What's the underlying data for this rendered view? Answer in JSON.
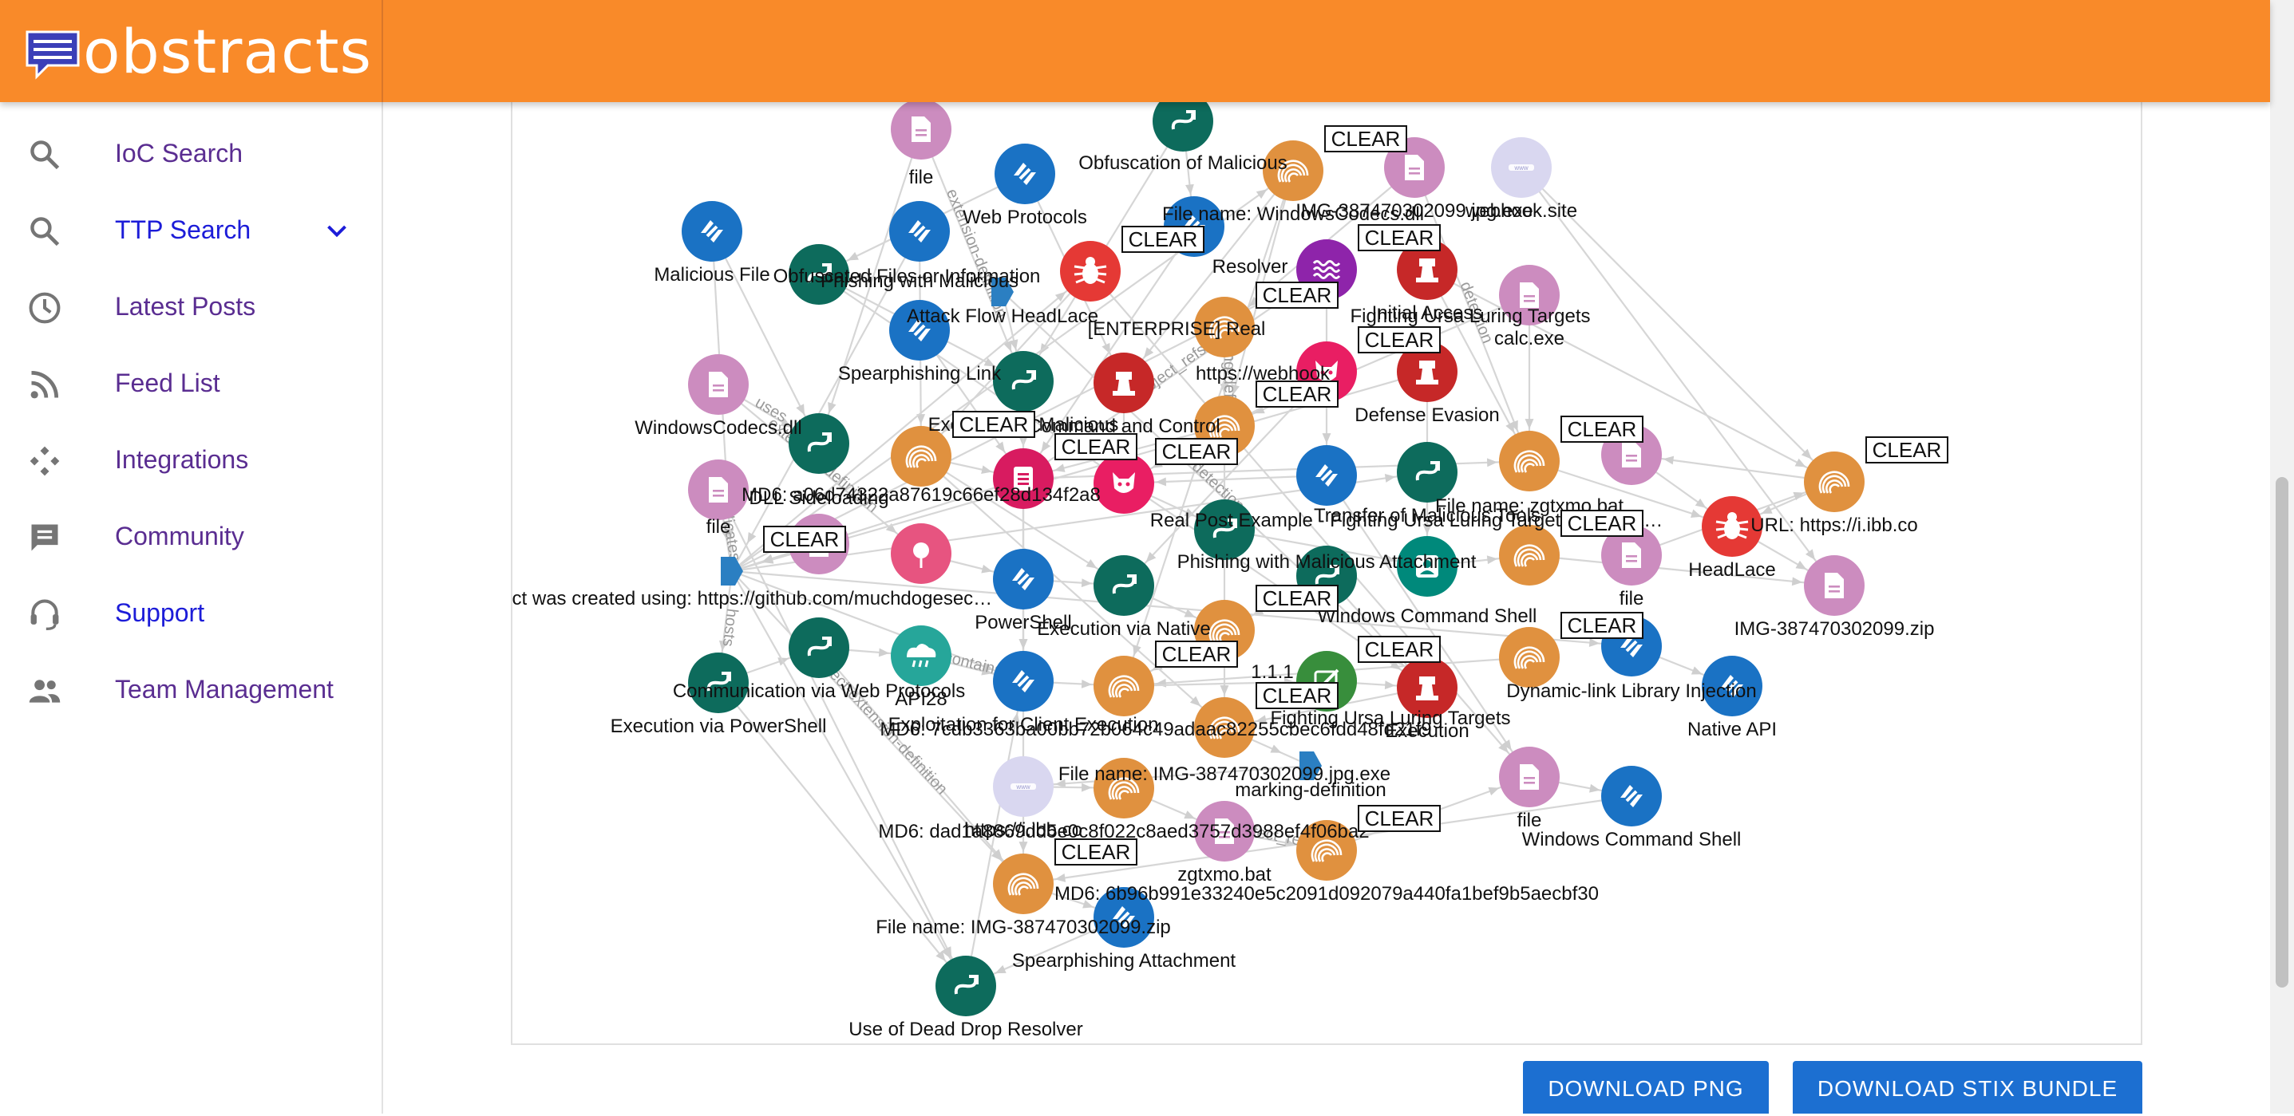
{
  "brand": {
    "name": "obstracts"
  },
  "nav": [
    {
      "key": "ioc",
      "label": "IoC Search",
      "icon": "search-icon",
      "active": false
    },
    {
      "key": "ttp",
      "label": "TTP Search",
      "icon": "search-icon",
      "active": true,
      "expandable": true
    },
    {
      "key": "latest",
      "label": "Latest Posts",
      "icon": "clock-icon",
      "active": false
    },
    {
      "key": "feeds",
      "label": "Feed List",
      "icon": "rss-icon",
      "active": false
    },
    {
      "key": "integrations",
      "label": "Integrations",
      "icon": "integrations-icon",
      "active": false
    },
    {
      "key": "community",
      "label": "Community",
      "icon": "chat-icon",
      "active": false
    },
    {
      "key": "support",
      "label": "Support",
      "icon": "support-icon",
      "active": true
    },
    {
      "key": "team",
      "label": "Team Management",
      "icon": "team-icon",
      "active": false
    }
  ],
  "buttons": {
    "download_png": "DOWNLOAD PNG",
    "download_stix": "DOWNLOAD STIX BUNDLE"
  },
  "colors": {
    "header": "#f98a29",
    "nav_text": "#5a2d91",
    "nav_active": "#1c1cd8",
    "button": "#1c6fd1",
    "attack_pattern": "#0d6b5c",
    "technique": "#1a72c4",
    "file": "#cc8cbf",
    "indicator": "#e0913f",
    "malware": "#e53935",
    "tactic": "#c62828",
    "domain": "#d9d7f0",
    "tlp_marking": "#2b7fc2",
    "report": "#d81b60",
    "threat_actor": "#e91e63",
    "infrastructure": "#8e24aa",
    "identity": "#00897b",
    "location": "#e75480",
    "cloud": "#26a69a",
    "note": "#388e3c",
    "edge": "#d6d6d6"
  },
  "graph": {
    "edge_labels": [
      "extension-definition",
      "object_refs",
      "object-extension-definition",
      "effect_refs",
      "contains",
      "hosts",
      "indicates",
      "uses",
      "marking-definition",
      "detection"
    ],
    "node_labels": [
      "file",
      "Obfuscation of Malicious",
      "Web Protocols",
      "File name: WindowsCodecs.dll",
      "IMG-387470302099.jpg.exe",
      "webhook.site",
      "Malicious File",
      "Obfuscated Files or Information",
      "Phishing with Malicious",
      "Resolver",
      "Attack Flow HeadLace",
      "[ENTERPRISE] Real",
      "Fighting Ursa Luring Targets",
      "Initial Access",
      "calc.exe",
      "Spearphishing Link",
      "https://webhook",
      "Defense Evasion",
      "Execution of Malicious",
      "Command and Control",
      "WindowsCodecs.dll",
      "MD6: a06d74322a87619c66ef28d134f2a8",
      "Real Post Example - Fighting Ursa Luring Targets With Car for Sale",
      "Transfer of Malicious Tools",
      "File name: zgtxmo.bat",
      "URL: https://i.ibb.co",
      "HeadLace",
      "DLL Sideloading",
      "Object was created using: https://github.com/muchdogesec/txt2stix",
      "Phishing with Malicious Attachment",
      "Windows Command Shell",
      "IMG-387470302099.zip",
      "PowerShell",
      "Execution via Native",
      "1.1.1",
      "Dynamic-link Library Injection",
      "Native API",
      "Communication via Web Protocols",
      "Execution via PowerShell",
      "API28",
      "Exploitation for Client Execution",
      "MD6: 7cdb3363ba00bb72b064c49adaac82255cbec6fdd48fd21f9",
      "Fighting Ursa Luring Targets",
      "Execution",
      "File name: IMG-387470302099.jpg.exe",
      "marking-definition",
      "https://i.ibb.co",
      "MD6: dad1a8869dd5e0c8f022c8aed3757d3988ef4f06ba2",
      "zgtxmo.bat",
      "MD6: 6b96b991e33240e5c2091d092079a440fa1bef9b5aecbf30",
      "File name: IMG-387470302099.zip",
      "Spearphishing Attachment",
      "Use of Dead Drop Resolver",
      "CLEAR"
    ]
  }
}
